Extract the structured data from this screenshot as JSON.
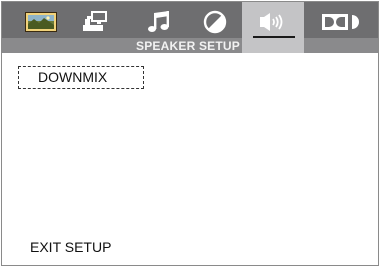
{
  "tabs": [
    {
      "name": "general",
      "icon": "landscape-picture-icon",
      "active": false
    },
    {
      "name": "video",
      "icon": "monitor-setup-icon",
      "active": false
    },
    {
      "name": "audio",
      "icon": "music-notes-icon",
      "active": false
    },
    {
      "name": "preference",
      "icon": "half-circle-icon",
      "active": false
    },
    {
      "name": "speaker",
      "icon": "speaker-sound-icon",
      "active": true
    },
    {
      "name": "dolby",
      "icon": "dolby-logo-icon",
      "active": false
    }
  ],
  "page": {
    "title": "SPEAKER SETUP"
  },
  "menu": {
    "items": [
      {
        "label": "DOWNMIX",
        "focused": true
      }
    ]
  },
  "footer": {
    "exit_label": "EXIT SETUP"
  },
  "colors": {
    "tabbar": "#6e6e70",
    "title_bar": "#8a8a8c",
    "active_tab": "#c4c4c6",
    "background": "#ffffff"
  }
}
